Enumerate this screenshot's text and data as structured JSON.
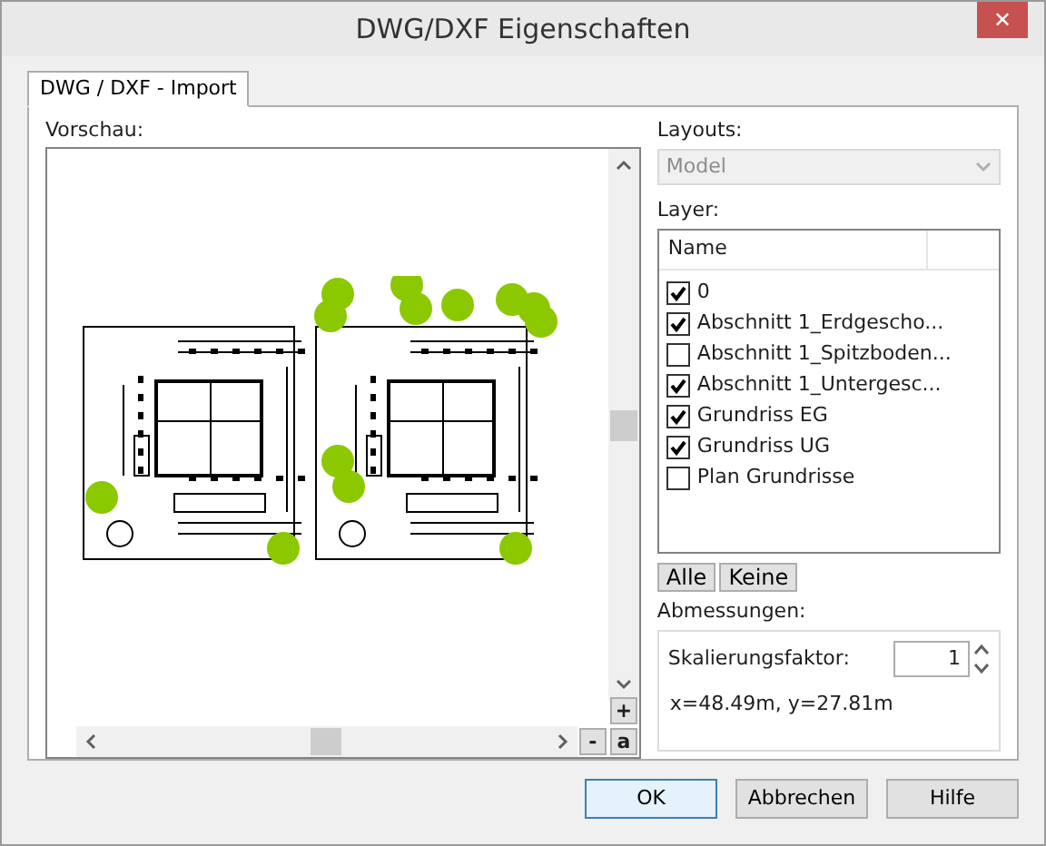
{
  "window": {
    "title": "DWG/DXF Eigenschaften",
    "close": "✕"
  },
  "tabs": [
    {
      "label": "DWG / DXF - Import",
      "selected": true
    }
  ],
  "preview": {
    "label": "Vorschau:",
    "zoom_in": "+",
    "zoom_out": "-",
    "fit": "a"
  },
  "layouts": {
    "label": "Layouts:",
    "value": "Model",
    "disabled": true
  },
  "layers": {
    "label": "Layer:",
    "column": "Name",
    "items": [
      {
        "name": "0",
        "checked": true
      },
      {
        "name": "Abschnitt 1_Erdgescho...",
        "checked": true
      },
      {
        "name": "Abschnitt 1_Spitzboden...",
        "checked": false
      },
      {
        "name": "Abschnitt 1_Untergesc...",
        "checked": true
      },
      {
        "name": "Grundriss EG",
        "checked": true
      },
      {
        "name": "Grundriss UG",
        "checked": true
      },
      {
        "name": "Plan Grundrisse",
        "checked": false
      }
    ]
  },
  "layer_buttons": [
    "Alle",
    "Keine"
  ],
  "dimensions": {
    "label": "Abmessungen:",
    "scale_label": "Skalierungsfaktor:",
    "scale_value": "1",
    "size": "x=48.49m, y=27.81m"
  },
  "buttons": [
    {
      "label": "OK",
      "default": true
    },
    {
      "label": "Abbrechen",
      "default": false
    },
    {
      "label": "Hilfe",
      "default": false
    }
  ]
}
